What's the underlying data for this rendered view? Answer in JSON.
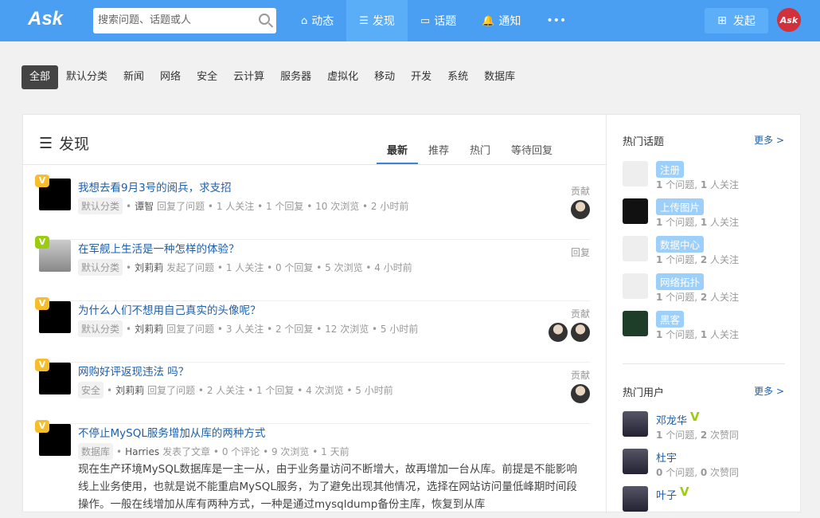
{
  "header": {
    "logo": "Ask",
    "search_placeholder": "搜索问题、话题或人",
    "nav": [
      {
        "label": "动态",
        "icon": "home-icon",
        "glyph": "⌂"
      },
      {
        "label": "发现",
        "icon": "list-icon",
        "glyph": "☰",
        "active": true
      },
      {
        "label": "话题",
        "icon": "chat-icon",
        "glyph": "▭"
      },
      {
        "label": "通知",
        "icon": "bell-icon",
        "glyph": "🔔"
      },
      {
        "label": "•••",
        "icon": "more-icon",
        "glyph": ""
      }
    ],
    "publish": "发起",
    "avatar": "Ask"
  },
  "categories": [
    {
      "label": "全部",
      "active": true
    },
    {
      "label": "默认分类"
    },
    {
      "label": "新闻"
    },
    {
      "label": "网络"
    },
    {
      "label": "安全"
    },
    {
      "label": "云计算"
    },
    {
      "label": "服务器"
    },
    {
      "label": "虚拟化"
    },
    {
      "label": "移动"
    },
    {
      "label": "开发"
    },
    {
      "label": "系统"
    },
    {
      "label": "数据库"
    }
  ],
  "main": {
    "title": "发现",
    "tabs": [
      {
        "label": "最新",
        "active": true
      },
      {
        "label": "推荐"
      },
      {
        "label": "热门"
      },
      {
        "label": "等待回复"
      }
    ],
    "items": [
      {
        "title": "我想去看9月3号的阅兵，求支招",
        "tag": "默认分类",
        "user": "谭智",
        "meta": "回复了问题 • 1 人关注 • 1 个回复 • 10 次浏览 • 2 小时前",
        "right": "贡献",
        "ravs": 1,
        "badge": "V",
        "badge_color": "#f7bd2a"
      },
      {
        "title": "在军舰上生活是一种怎样的体验？",
        "tag": "默认分类",
        "user": "刘莉莉",
        "meta": "发起了问题 • 1 人关注 • 0 个回复 • 5 次浏览 • 4 小时前",
        "right": "回复",
        "ravs": 0,
        "badge": "V",
        "badge_color": "#9ccc0e",
        "photo": true
      },
      {
        "title": "为什么人们不想用自己真实的头像呢？",
        "tag": "默认分类",
        "user": "刘莉莉",
        "meta": "回复了问题 • 3 人关注 • 2 个回复 • 12 次浏览 • 5 小时前",
        "right": "贡献",
        "ravs": 2,
        "badge": "V",
        "badge_color": "#f7bd2a"
      },
      {
        "title": "网购好评返现违法 吗？",
        "tag": "安全",
        "user": "刘莉莉",
        "meta": "回复了问题 • 2 人关注 • 1 个回复 • 4 次浏览 • 5 小时前",
        "right": "贡献",
        "ravs": 1,
        "badge": "V",
        "badge_color": "#f7bd2a"
      },
      {
        "title": "不停止MySQL服务增加从库的两种方式",
        "tag": "数据库",
        "user": "Harries",
        "meta": "发表了文章 • 0 个评论 • 9 次浏览 • 1 天前",
        "right": "",
        "ravs": 0,
        "badge": "V",
        "badge_color": "#f7bd2a",
        "excerpt": "现在生产环境MySQL数据库是一主一从，由于业务量访问不断增大，故再增加一台从库。前提是不能影响线上业务使用，也就是说不能重启MySQL服务，为了避免出现其他情况，选择在网站访问量低峰期时间段操作。一般在线增加从库有两种方式，一种是通过mysqldump备份主库，恢复到从库"
      }
    ]
  },
  "sidebar": {
    "topics_title": "热门话题",
    "more": "更多 >",
    "topics": [
      {
        "name": "注册",
        "q": "1",
        "f": "1",
        "q_label": "个问题,",
        "f_label": "人关注",
        "img": "placeholder"
      },
      {
        "name": "上传图片",
        "q": "1",
        "f": "1",
        "q_label": "个问题,",
        "f_label": "人关注",
        "img": "dark"
      },
      {
        "name": "数据中心",
        "q": "1",
        "f": "2",
        "q_label": "个问题,",
        "f_label": "人关注",
        "img": "placeholder"
      },
      {
        "name": "网络拓扑",
        "q": "1",
        "f": "2",
        "q_label": "个问题,",
        "f_label": "人关注",
        "img": "placeholder"
      },
      {
        "name": "黑客",
        "q": "1",
        "f": "1",
        "q_label": "个问题,",
        "f_label": "人关注",
        "img": "grn"
      }
    ],
    "users_title": "热门用户",
    "users": [
      {
        "name": "邓龙华",
        "v": true,
        "q": "1",
        "a": "2",
        "q_label": "个问题,",
        "a_label": "次赞同"
      },
      {
        "name": "杜宇",
        "v": false,
        "q": "0",
        "a": "0",
        "q_label": "个问题,",
        "a_label": "次赞同"
      },
      {
        "name": "叶子",
        "v": true,
        "q": "",
        "a": "",
        "q_label": "",
        "a_label": ""
      }
    ]
  }
}
